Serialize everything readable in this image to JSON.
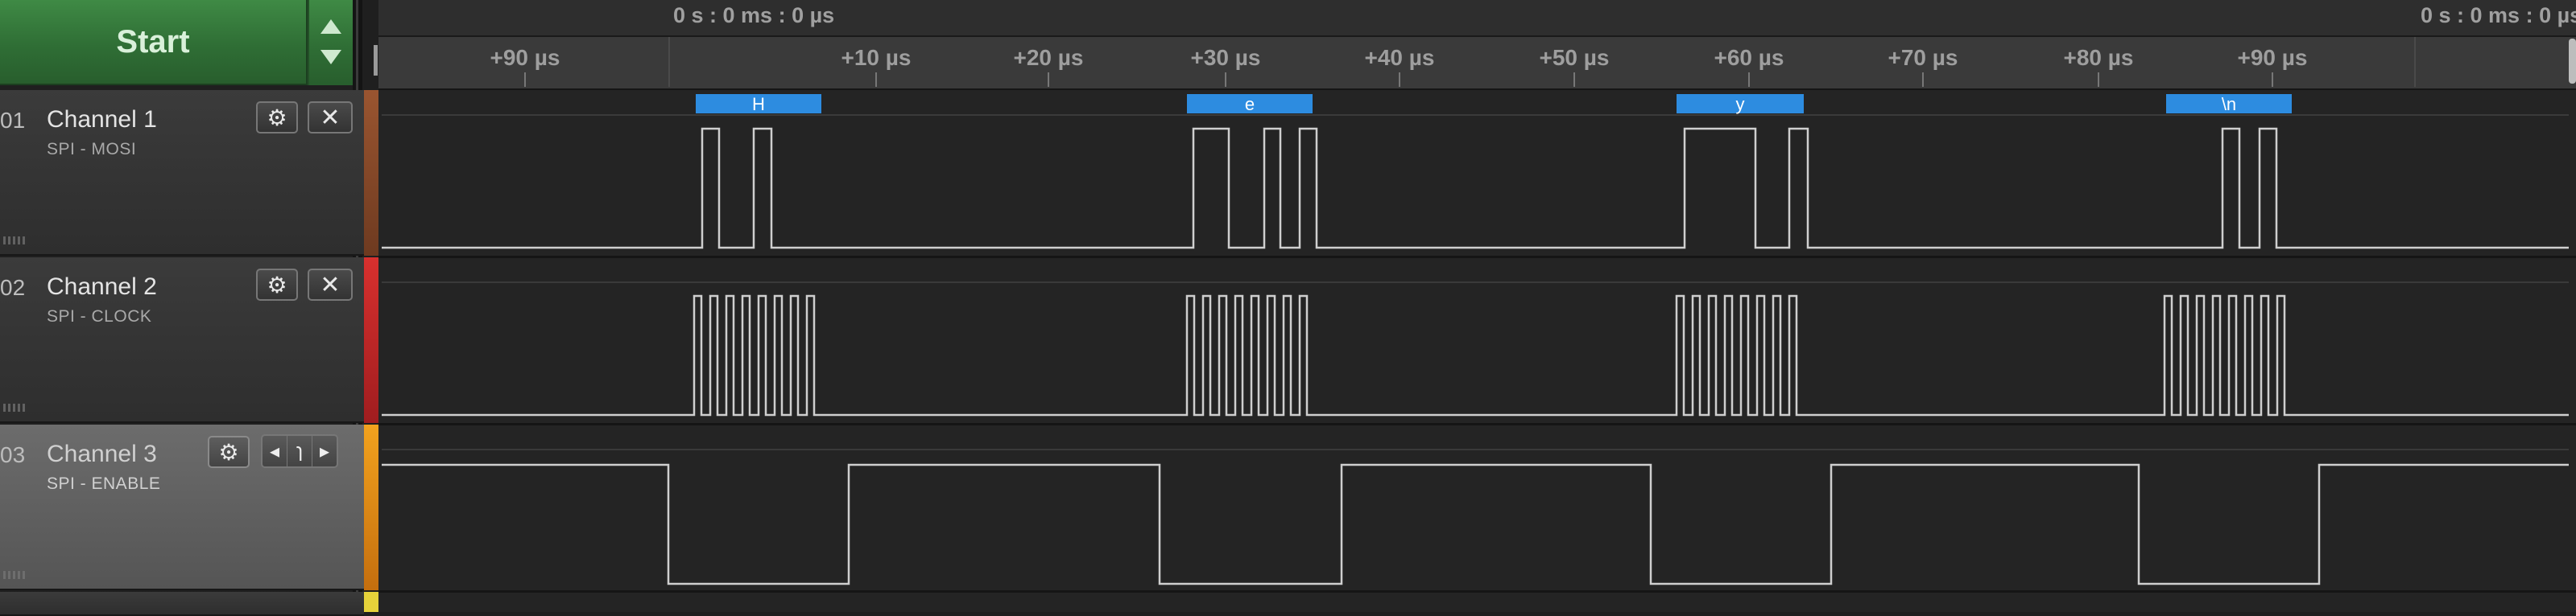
{
  "toolbar": {
    "start_label": "Start"
  },
  "ruler": {
    "left_time": "0 s : 0 ms : 0 µs",
    "right_time": "0 s : 0 ms : 0 µs",
    "ticks": [
      "+90 µs",
      "+10 µs",
      "+20 µs",
      "+30 µs",
      "+40 µs",
      "+50 µs",
      "+60 µs",
      "+70 µs",
      "+80 µs",
      "+90 µs"
    ]
  },
  "channels": [
    {
      "num": "01",
      "name": "Channel 1",
      "sub": "SPI - MOSI",
      "color": "#8c4a2a"
    },
    {
      "num": "02",
      "name": "Channel 2",
      "sub": "SPI - CLOCK",
      "color": "#c0282a"
    },
    {
      "num": "03",
      "name": "Channel 3",
      "sub": "SPI - ENABLE",
      "color": "#e08a1a"
    }
  ],
  "decoded": [
    "H",
    "e",
    "y",
    "\\n"
  ],
  "colors": {
    "decode_bubble": "#2d8ce0",
    "trace": "#cfcfcf",
    "start_green": "#2f6e35"
  },
  "icons": {
    "settings": "gear-icon",
    "remove": "close-icon",
    "trigger_prev": "caret-left-icon",
    "trigger_edge": "falling-edge-icon",
    "trigger_next": "caret-right-icon"
  }
}
